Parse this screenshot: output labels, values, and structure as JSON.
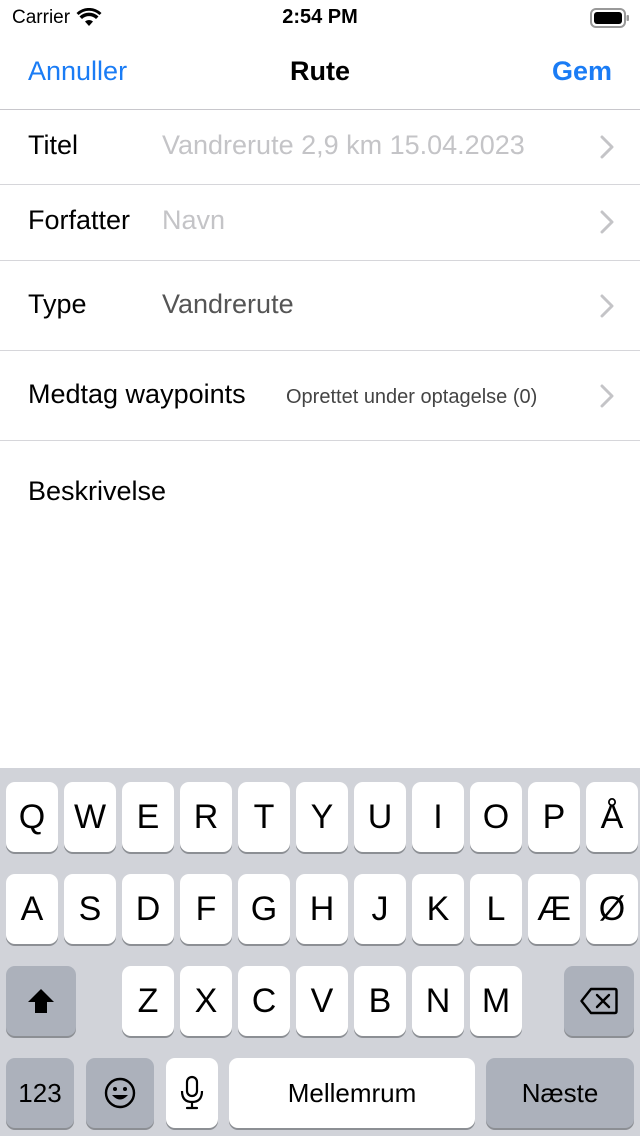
{
  "status_bar": {
    "carrier": "Carrier",
    "time": "2:54 PM"
  },
  "nav": {
    "cancel_label": "Annuller",
    "title": "Rute",
    "save_label": "Gem",
    "accent_color": "#1a7cf5"
  },
  "form": {
    "title": {
      "label": "Titel",
      "placeholder": "Vandrerute 2,9 km 15.04.2023"
    },
    "author": {
      "label": "Forfatter",
      "placeholder": "Navn"
    },
    "type": {
      "label": "Type",
      "value": "Vandrerute"
    },
    "waypoints": {
      "label": "Medtag waypoints",
      "value": "Oprettet under optagelse (0)"
    },
    "description": {
      "label": "Beskrivelse"
    }
  },
  "keyboard": {
    "row1": [
      "Q",
      "W",
      "E",
      "R",
      "T",
      "Y",
      "U",
      "I",
      "O",
      "P",
      "Å"
    ],
    "row2": [
      "A",
      "S",
      "D",
      "F",
      "G",
      "H",
      "J",
      "K",
      "L",
      "Æ",
      "Ø"
    ],
    "row3": [
      "Z",
      "X",
      "C",
      "V",
      "B",
      "N",
      "M"
    ],
    "numbers_label": "123",
    "space_label": "Mellemrum",
    "next_label": "Næste",
    "shift_icon": "shift-icon",
    "delete_icon": "delete-icon",
    "emoji_icon": "emoji-icon",
    "mic_icon": "microphone-icon"
  }
}
